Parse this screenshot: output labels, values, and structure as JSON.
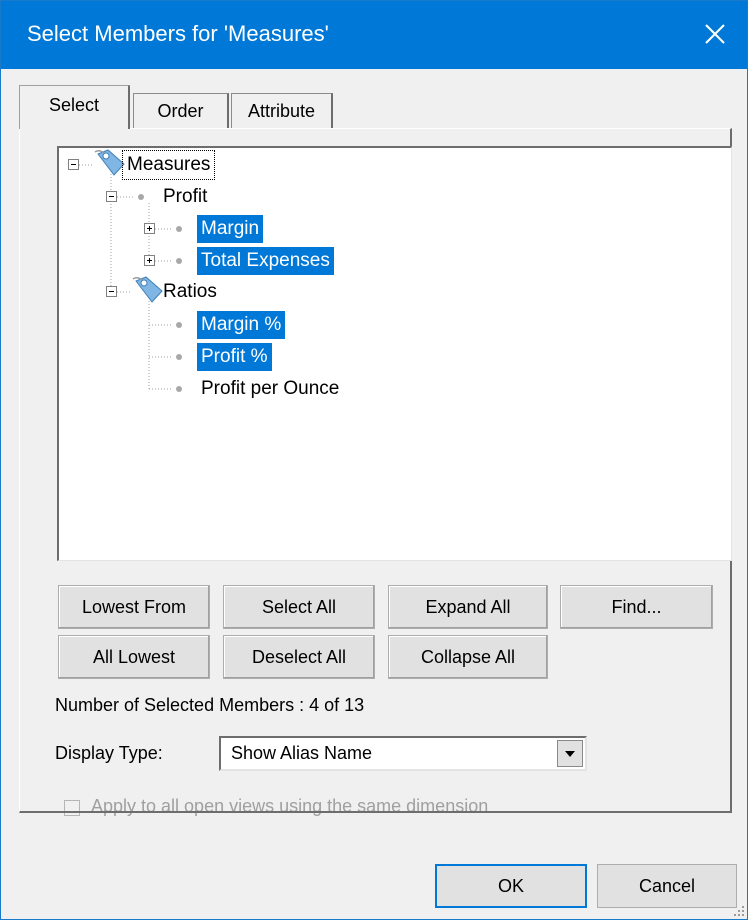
{
  "window": {
    "title": "Select Members for 'Measures'"
  },
  "tabs": [
    {
      "label": "Select",
      "active": true
    },
    {
      "label": "Order",
      "active": false
    },
    {
      "label": "Attribute",
      "active": false
    }
  ],
  "tree": {
    "nodes": [
      {
        "label": "Measures",
        "icon": "member-tag-icon",
        "expander": "collapse",
        "selected": false
      },
      {
        "label": "Profit",
        "icon": "bullet",
        "expander": "collapse",
        "selected": false
      },
      {
        "label": "Margin",
        "icon": "bullet",
        "expander": "expand",
        "selected": true
      },
      {
        "label": "Total Expenses",
        "icon": "bullet",
        "expander": "expand",
        "selected": true
      },
      {
        "label": "Ratios",
        "icon": "member-tag-icon",
        "expander": "collapse",
        "selected": false
      },
      {
        "label": "Margin %",
        "icon": "bullet",
        "selected": true
      },
      {
        "label": "Profit %",
        "icon": "bullet",
        "selected": true
      },
      {
        "label": "Profit per Ounce",
        "icon": "bullet",
        "selected": false
      }
    ]
  },
  "buttons": {
    "lowest_from": "Lowest From",
    "select_all": "Select All",
    "expand_all": "Expand All",
    "find": "Find...",
    "all_lowest": "All Lowest",
    "deselect_all": "Deselect All",
    "collapse_all": "Collapse All"
  },
  "status": {
    "selected_count": "Number of Selected Members : 4 of 13"
  },
  "display_type": {
    "label": "Display Type:",
    "value": "Show Alias Name"
  },
  "apply_all": {
    "label": "Apply to all open views using the same dimension",
    "checked": false,
    "enabled": false
  },
  "footer": {
    "ok": "OK",
    "cancel": "Cancel"
  },
  "colors": {
    "titlebar": "#0078d7",
    "selection": "#0078d7",
    "dialog_bg": "#f0f0f0"
  }
}
